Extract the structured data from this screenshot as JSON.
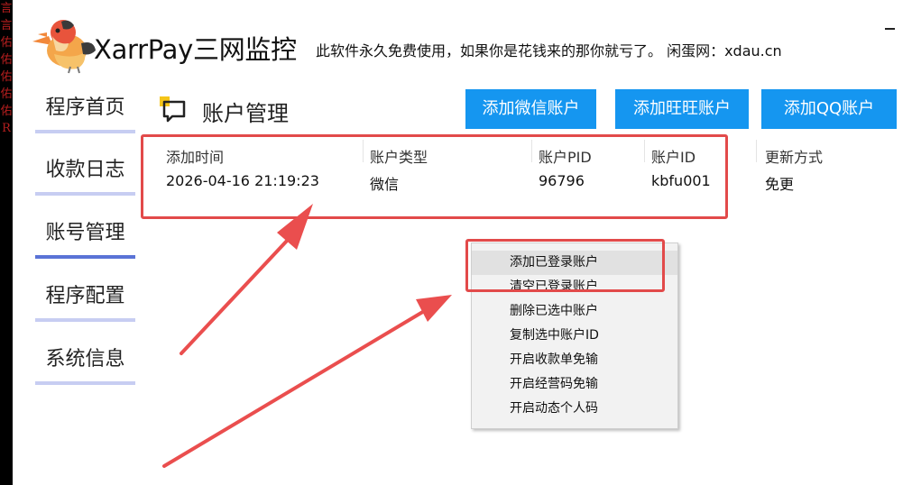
{
  "background_glyphs": [
    "言",
    "言",
    "佑",
    "佑",
    "佑",
    "佑",
    "佑",
    "R"
  ],
  "app": {
    "title": "XarrPay三网监控",
    "subtitle": "此软件永久免费使用，如果你是花钱来的那你就亏了。 闲蛋网：xdau.cn",
    "minimize_label": "-"
  },
  "nav": {
    "items": [
      {
        "label": "程序首页",
        "active": false
      },
      {
        "label": "收款日志",
        "active": false
      },
      {
        "label": "账号管理",
        "active": true
      },
      {
        "label": "程序配置",
        "active": false
      },
      {
        "label": "系统信息",
        "active": false
      }
    ]
  },
  "section": {
    "title": "账户管理",
    "icon": "chat-bubble-icon"
  },
  "buttons": {
    "add_wechat": "添加微信账户",
    "add_wangwang": "添加旺旺账户",
    "add_qq": "添加QQ账户",
    "color": "#1596f0"
  },
  "table": {
    "headers": [
      "添加时间",
      "账户类型",
      "账户PID",
      "账户ID",
      "更新方式"
    ],
    "rows": [
      [
        "2026-04-16 21:19:23",
        "微信",
        "96796",
        "kbfu001",
        "免更"
      ]
    ]
  },
  "context_menu": {
    "items": [
      "添加已登录账户",
      "清空已登录账户",
      "删除已选中账户",
      "复制选中账户ID",
      "开启收款单免输",
      "开启经营码免输",
      "开启动态个人码"
    ],
    "hovered_index": 0
  },
  "annotation_color": "#e24a4a"
}
